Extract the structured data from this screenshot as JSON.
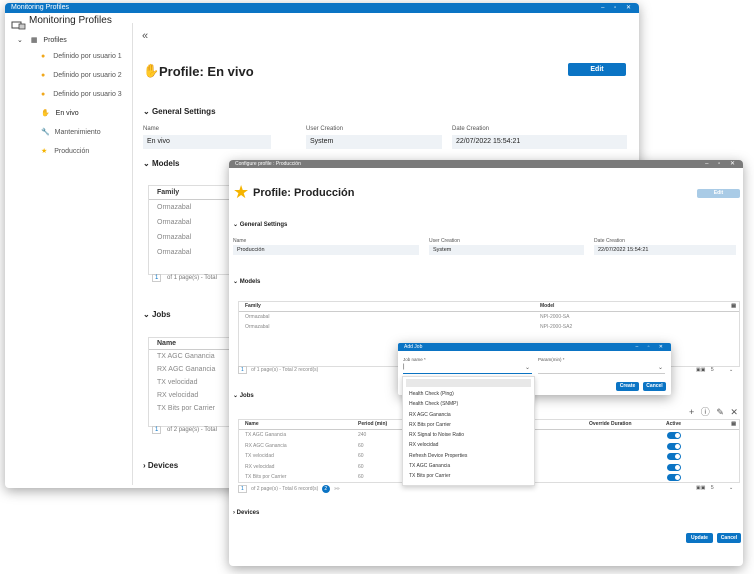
{
  "main_window": {
    "title": "Monitoring Profiles",
    "app_title": "Monitoring Profiles",
    "tree": {
      "root": "Profiles",
      "items": [
        {
          "label": "Definido por usuario 1",
          "icon": "user-icon"
        },
        {
          "label": "Definido por usuario 2",
          "icon": "user-icon"
        },
        {
          "label": "Definido por usuario 3",
          "icon": "user-icon"
        },
        {
          "label": "En vivo",
          "icon": "hand-icon"
        },
        {
          "label": "Mantenimiento",
          "icon": "wrench-icon"
        },
        {
          "label": "Producción",
          "icon": "star-icon"
        }
      ]
    },
    "collapse": "«",
    "profile_title": "Profile: En vivo",
    "edit_label": "Edit",
    "general_settings": "General Settings",
    "labels": {
      "name": "Name",
      "user_creation": "User Creation",
      "date_creation": "Date Creation"
    },
    "values": {
      "name": "En vivo",
      "user_creation": "System",
      "date_creation": "22/07/2022 15:54:21"
    },
    "models": "Models",
    "models_table": {
      "header": "Family",
      "rows": [
        "Ormazabal",
        "Ormazabal",
        "Ormazabal",
        "Ormazabal"
      ]
    },
    "models_pager": {
      "page": "1",
      "of": "of",
      "total": "1",
      "suffix": "page(s) - Total"
    },
    "jobs": "Jobs",
    "jobs_table": {
      "header": "Name",
      "rows": [
        "TX AGC Ganancia",
        "RX AGC Ganancia",
        "TX velocidad",
        "RX velocidad",
        "TX Bits por Carrier"
      ]
    },
    "jobs_pager": {
      "page": "1",
      "of": "of",
      "total": "2",
      "suffix": "page(s) - Total"
    },
    "devices": "Devices"
  },
  "config_window": {
    "title": "Configure profile : Producción",
    "profile_title": "Profile: Producción",
    "edit_label": "Edit",
    "general_settings": "General Settings",
    "labels": {
      "name": "Name",
      "user_creation": "User Creation",
      "date_creation": "Date Creation"
    },
    "values": {
      "name": "Producción",
      "user_creation": "System",
      "date_creation": "22/07/2022 15:54:21"
    },
    "models": "Models",
    "models_table": {
      "family": "Family",
      "model": "Model",
      "rows": [
        {
          "family": "Ormazabal",
          "model": "NPI-2000-SA"
        },
        {
          "family": "Ormazabal",
          "model": "NPI-2000-SA2"
        }
      ]
    },
    "models_pager": {
      "page": "1",
      "text": "of 1 page(s) - Total 2 record(s)",
      "size": "5"
    },
    "jobs": "Jobs",
    "jobs_table": {
      "headers": [
        "Name",
        "Period (min)",
        "Override Duration",
        "Active"
      ],
      "rows": [
        {
          "name": "TX AGC Ganancia",
          "period": "240"
        },
        {
          "name": "RX AGC Ganancia",
          "period": "60"
        },
        {
          "name": "TX velocidad",
          "period": "60"
        },
        {
          "name": "RX velocidad",
          "period": "60"
        },
        {
          "name": "TX Bits por Carrier",
          "period": "60"
        }
      ]
    },
    "jobs_pager": {
      "page": "1",
      "text": "of 2 page(s) - Total 6 record(s)",
      "next": "2",
      "last": "»»",
      "size": "5"
    },
    "devices": "Devices",
    "update_label": "Update",
    "cancel_label": "Cancel"
  },
  "add_job": {
    "title": "Add Job",
    "job_name_label": "Job name *",
    "params_label": "Param(min) *",
    "options": [
      "Health Check (Ping)",
      "Health Check (SNMP)",
      "RX AGC Ganancia",
      "RX Bits por Carrier",
      "RX Signal to Noise Ratio",
      "RX velocidad",
      "Refresh Device Properties",
      "TX AGC Ganancia",
      "TX Bits por Carrier"
    ],
    "create_label": "Create",
    "cancel_label": "Cancel"
  },
  "colors": {
    "accent": "#0b74c4",
    "star": "#f5b400",
    "user": "#f0a81c"
  }
}
